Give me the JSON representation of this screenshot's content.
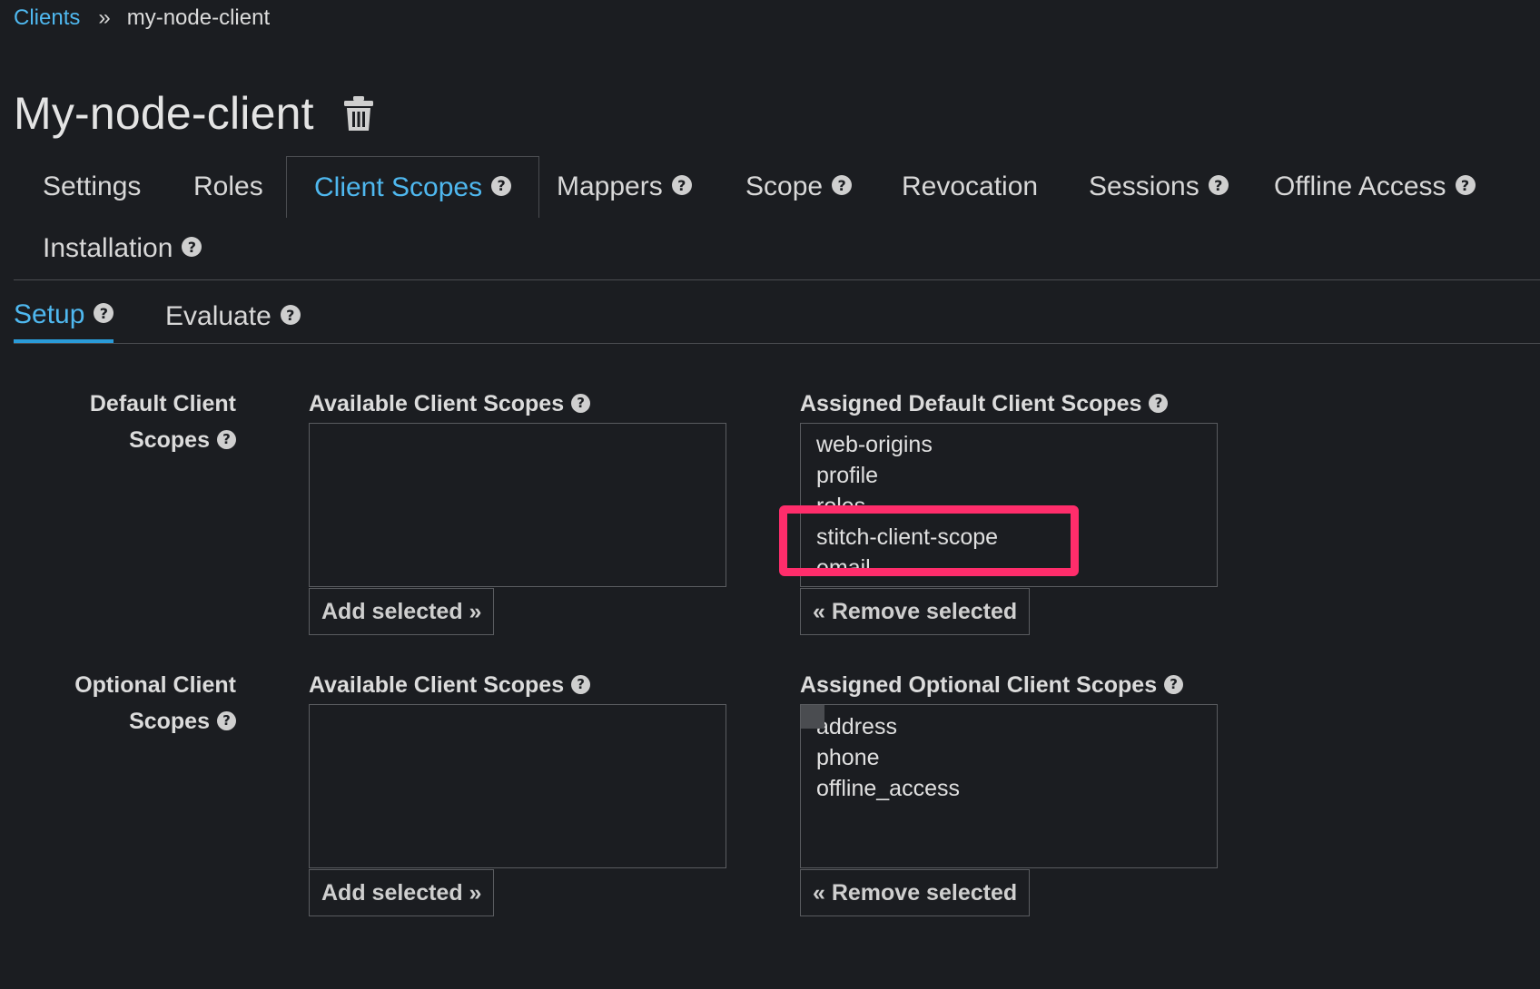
{
  "breadcrumb": {
    "parent": "Clients",
    "separator": "»",
    "current": "my-node-client"
  },
  "page": {
    "title": "My-node-client",
    "delete_icon": "trash-icon"
  },
  "tabs": [
    {
      "label": "Settings",
      "help": false,
      "active": false
    },
    {
      "label": "Roles",
      "help": false,
      "active": false
    },
    {
      "label": "Client Scopes",
      "help": true,
      "active": true
    },
    {
      "label": "Mappers",
      "help": true,
      "active": false
    },
    {
      "label": "Scope",
      "help": true,
      "active": false
    },
    {
      "label": "Revocation",
      "help": false,
      "active": false
    },
    {
      "label": "Sessions",
      "help": true,
      "active": false
    },
    {
      "label": "Offline Access",
      "help": true,
      "active": false
    },
    {
      "label": "Installation",
      "help": true,
      "active": false
    }
  ],
  "subtabs": [
    {
      "label": "Setup",
      "active": true
    },
    {
      "label": "Evaluate",
      "active": false
    }
  ],
  "default_scopes": {
    "row_label_line1": "Default Client",
    "row_label_line2": "Scopes",
    "available_label": "Available Client Scopes",
    "available_items": [],
    "add_button": "Add selected »",
    "assigned_label": "Assigned Default Client Scopes",
    "assigned_items": [
      "web-origins",
      "profile",
      "roles",
      "stitch-client-scope",
      "email"
    ],
    "remove_button": "« Remove selected"
  },
  "optional_scopes": {
    "row_label_line1": "Optional Client",
    "row_label_line2": "Scopes",
    "available_label": "Available Client Scopes",
    "available_items": [],
    "add_button": "Add selected »",
    "assigned_label": "Assigned Optional Client Scopes",
    "assigned_items": [
      "address",
      "phone",
      "offline_access"
    ],
    "remove_button": "« Remove selected"
  },
  "colors": {
    "background": "#1b1d21",
    "link": "#4fb8ef",
    "highlight": "#ff2d6b"
  }
}
